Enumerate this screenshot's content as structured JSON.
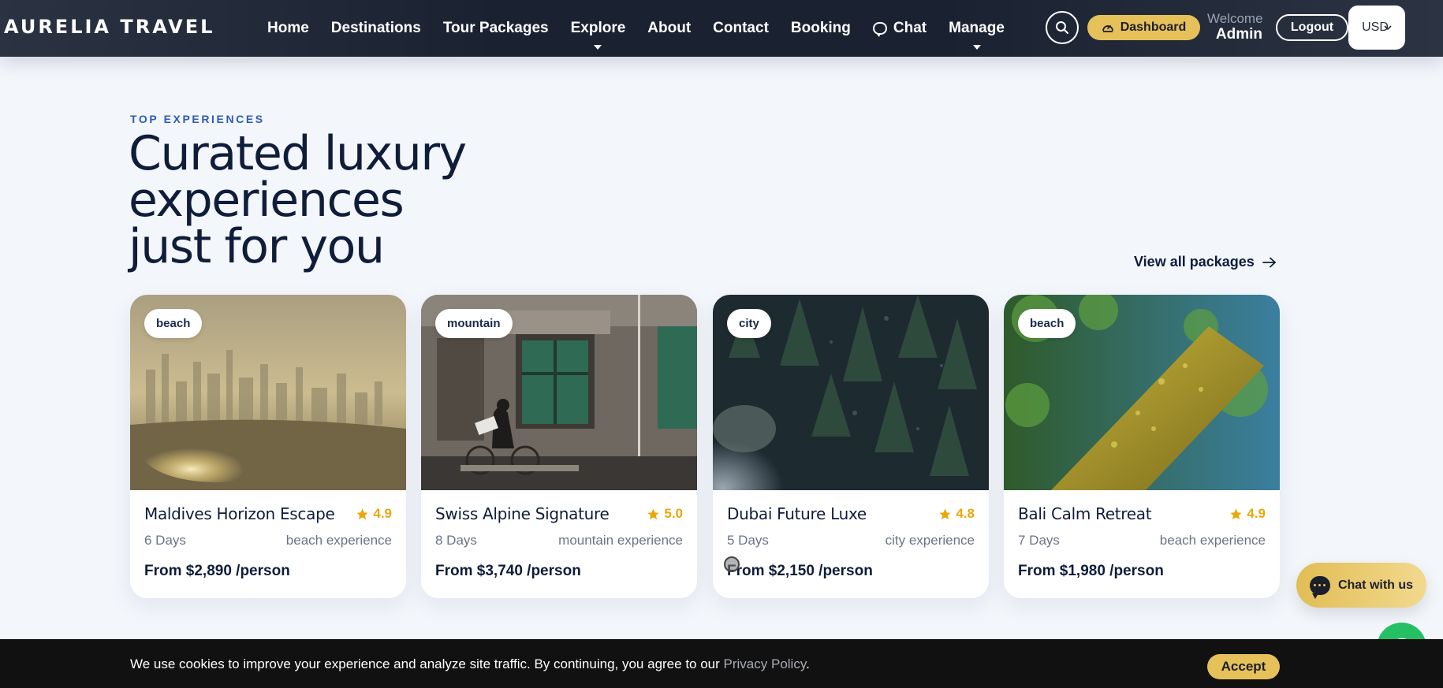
{
  "brand": "AURELIA TRAVEL",
  "nav": {
    "links": [
      "Home",
      "Destinations",
      "Tour Packages",
      "Explore",
      "About",
      "Contact",
      "Booking",
      "Chat",
      "Manage"
    ],
    "dashboard_label": "Dashboard",
    "welcome_label": "Welcome",
    "user_name": "Admin",
    "logout_label": "Logout",
    "currency": "USD"
  },
  "section": {
    "eyebrow": "TOP EXPERIENCES",
    "headline": "Curated luxury experiences just for you",
    "view_all": "View all packages"
  },
  "cards": [
    {
      "tag": "beach",
      "title": "Maldives Horizon Escape",
      "rating": "4.9",
      "days": "6 Days",
      "experience": "beach experience",
      "price": "From $2,890 /person"
    },
    {
      "tag": "mountain",
      "title": "Swiss Alpine Signature",
      "rating": "5.0",
      "days": "8 Days",
      "experience": "mountain experience",
      "price": "From $3,740 /person"
    },
    {
      "tag": "city",
      "title": "Dubai Future Luxe",
      "rating": "4.8",
      "days": "5 Days",
      "experience": "city experience",
      "price": "From $2,150 /person"
    },
    {
      "tag": "beach",
      "title": "Bali Calm Retreat",
      "rating": "4.9",
      "days": "7 Days",
      "experience": "beach experience",
      "price": "From $1,980 /person"
    }
  ],
  "chat_float": "Chat with us",
  "cookie": {
    "text": "We use cookies to improve your experience and analyze site traffic. By continuing, you agree to our",
    "link": "Privacy Policy",
    "end": ".",
    "accept": "Accept"
  },
  "colors": {
    "accent_gold": "#e6c15a",
    "navy": "#0f1d3a",
    "eyebrow_blue": "#2e5bb8",
    "star": "#e8a80c",
    "nav_bg": "#1a2232"
  }
}
